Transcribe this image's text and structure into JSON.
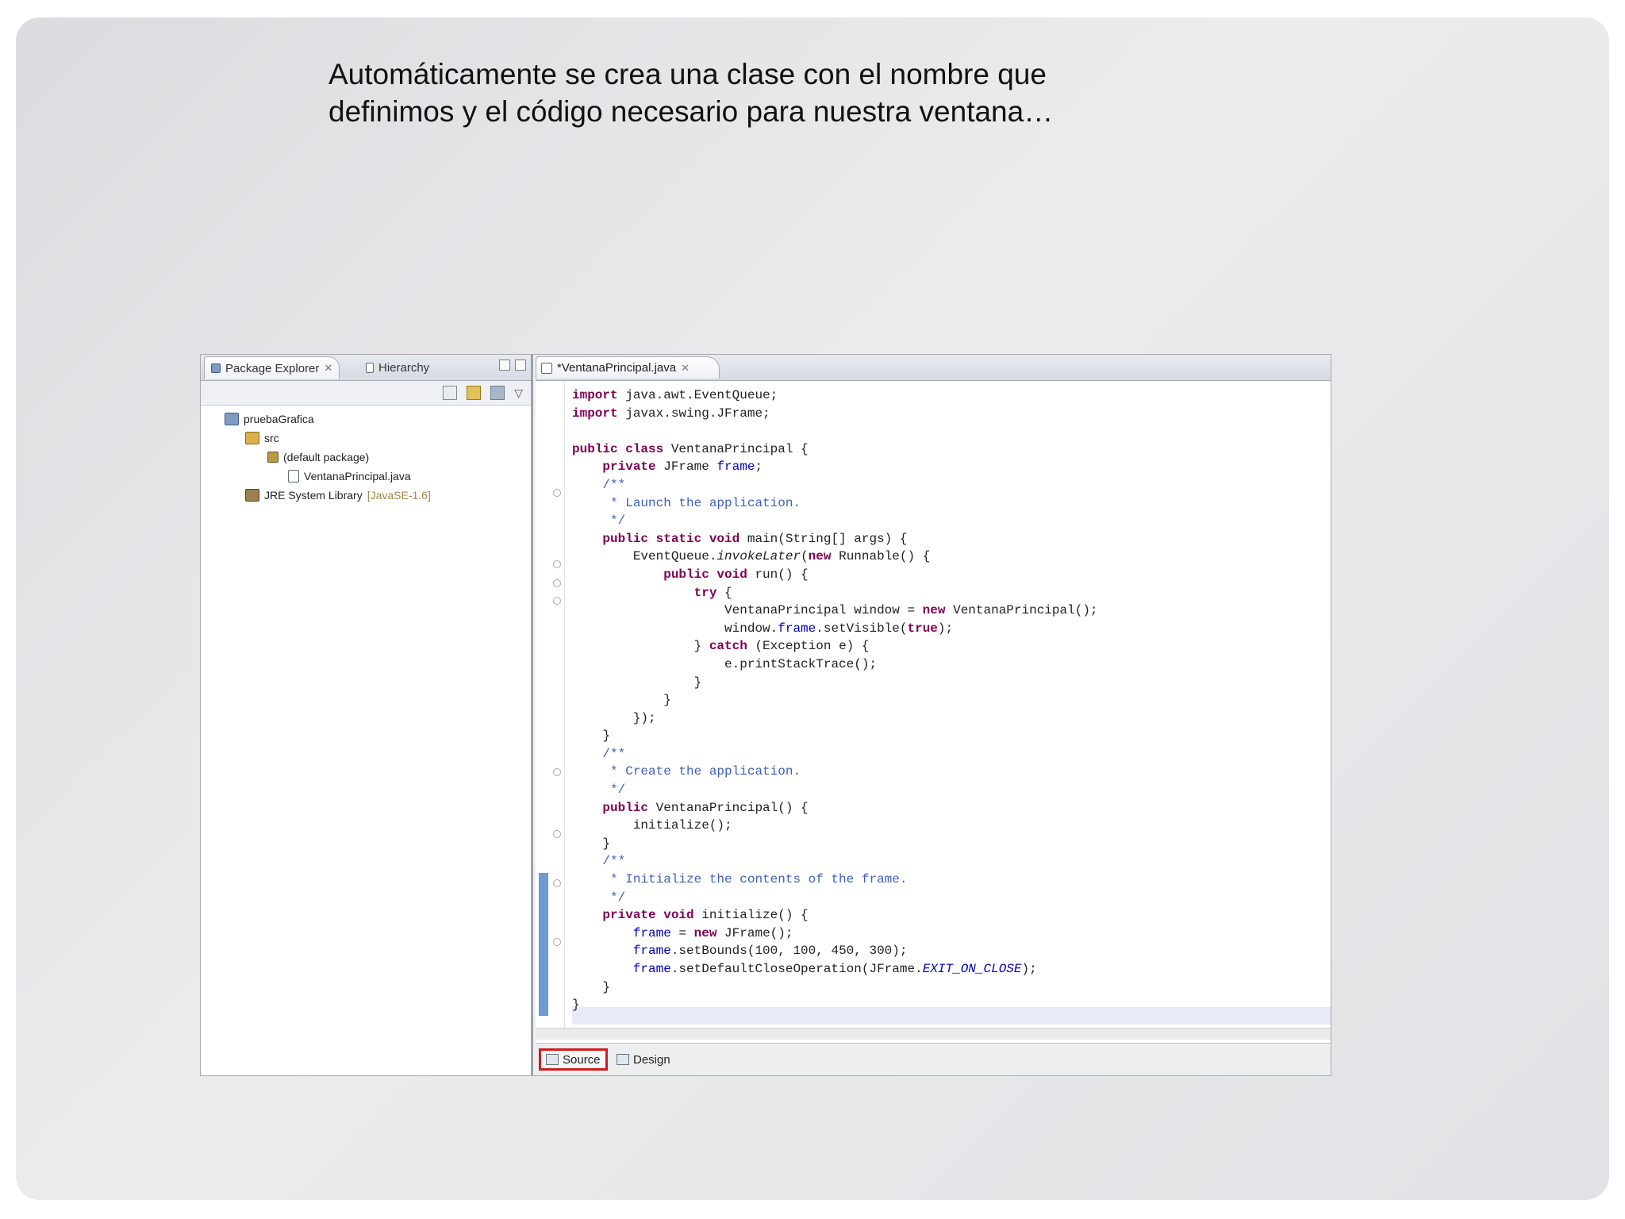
{
  "caption": {
    "line1": "Automáticamente se crea una clase con el nombre que",
    "line2": "definimos y el código necesario para nuestra ventana…"
  },
  "left_panel": {
    "tabs": [
      "Package Explorer",
      "Hierarchy"
    ],
    "tree": {
      "project": "pruebaGrafica",
      "src": "src",
      "package": "(default package)",
      "file": "VentanaPrincipal.java",
      "library": "JRE System Library",
      "library_version": "[JavaSE-1.6]"
    }
  },
  "editor": {
    "tab_title": "*VentanaPrincipal.java",
    "bottom_tabs": {
      "source": "Source",
      "design": "Design"
    }
  },
  "colors": {
    "highlight": "#d01d1d",
    "keyword": "#7f0055",
    "field": "#0000c0",
    "comment": "#3f5fbf"
  }
}
